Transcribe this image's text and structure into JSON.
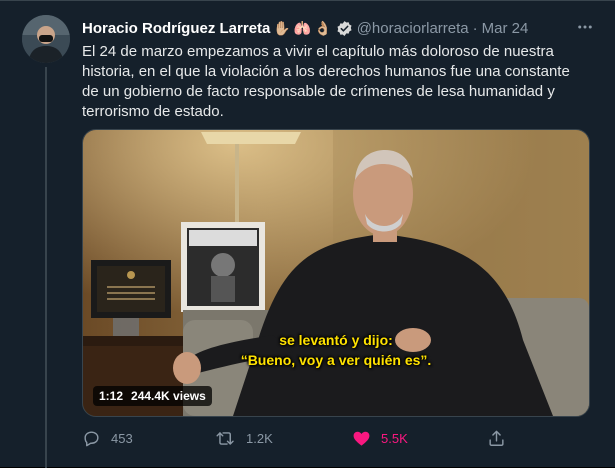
{
  "tweet": {
    "author_name": "Horacio Rodríguez Larreta",
    "author_emoji": [
      "✋🏼",
      "🫁",
      "👌🏼"
    ],
    "handle": "@horaciorlarreta",
    "separator": "·",
    "date": "Mar 24",
    "text": "El 24 de marzo empezamos a vivir el capítulo más doloroso de nuestra historia, en el que la violación a los derechos humanos fue una constante de un gobierno de facto responsable de crímenes de lesa humanidad y terrorismo de estado.",
    "media": {
      "subtitle_line1": "se levantó y dijo:",
      "subtitle_line2": "“Bueno, voy a ver quién es”.",
      "duration": "1:12",
      "views": "244.4K views"
    },
    "actions": {
      "replies": "453",
      "retweets": "1.2K",
      "likes": "5.5K"
    }
  },
  "colors": {
    "background": "#15202b",
    "text": "#e7e9ea",
    "secondary": "#8b98a5",
    "like": "#f91880",
    "subtitle": "#ffe200"
  },
  "icons": [
    "more-icon",
    "verified-icon",
    "reply-icon",
    "retweet-icon",
    "like-icon",
    "share-icon"
  ]
}
